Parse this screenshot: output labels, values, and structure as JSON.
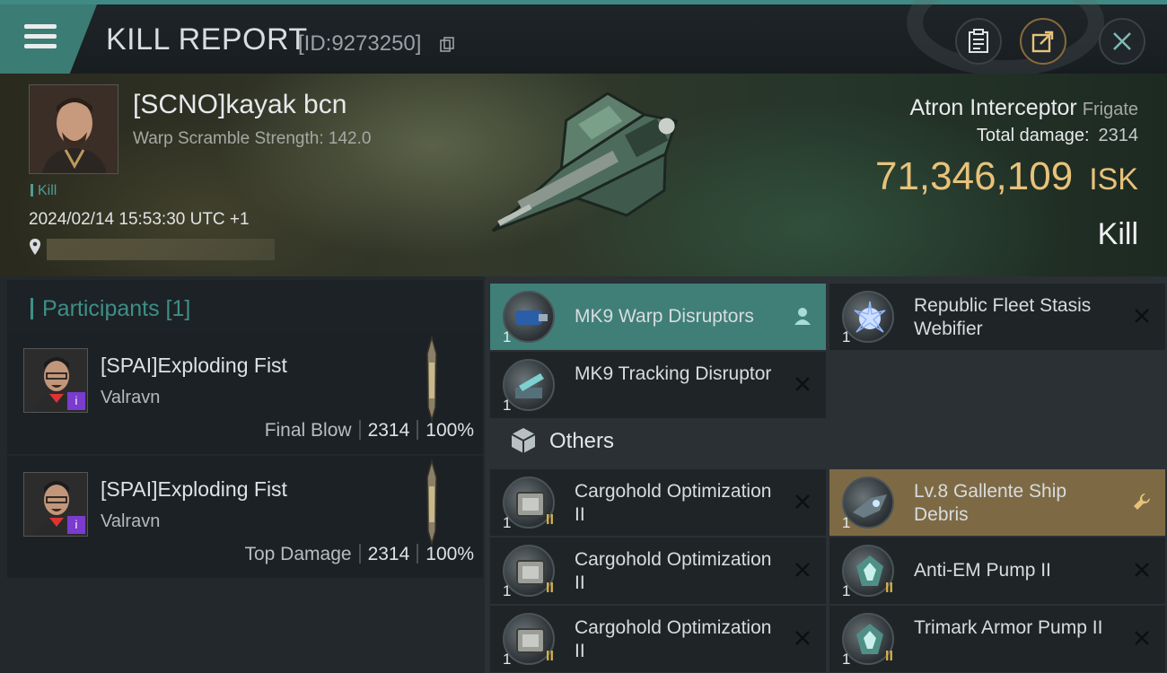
{
  "header": {
    "title": "KILL REPORT",
    "report_id": "[ID:9273250]"
  },
  "victim": {
    "name": "[SCNO]kayak bcn",
    "warp_scramble": "Warp Scramble Strength: 142.0",
    "kill_tag": "Kill",
    "datetime": "2024/02/14 15:53:30 UTC +1"
  },
  "ship": {
    "name": "Atron Interceptor",
    "class": "Frigate",
    "total_damage_label": "Total damage:",
    "total_damage": "2314",
    "isk_value": "71,346,109",
    "isk_unit": "ISK",
    "result": "Kill"
  },
  "participants": {
    "header": "Participants [1]",
    "rows": [
      {
        "name": "[SPAI]Exploding Fist",
        "ship": "Valravn",
        "role": "Final Blow",
        "damage": "2314",
        "percent": "100%"
      },
      {
        "name": "[SPAI]Exploding Fist",
        "ship": "Valravn",
        "role": "Top Damage",
        "damage": "2314",
        "percent": "100%"
      }
    ]
  },
  "items": {
    "mk9_warp": {
      "name": "MK9 Warp Disruptors",
      "qty": "1"
    },
    "webifier": {
      "name": "Republic Fleet Stasis Webifier",
      "qty": "1"
    },
    "tracking": {
      "name": "MK9 Tracking Disruptor",
      "qty": "1"
    },
    "others_label": "Others",
    "cargo1": {
      "name": "Cargohold Optimization II",
      "qty": "1",
      "tier": "II"
    },
    "debris": {
      "name": "Lv.8 Gallente Ship Debris",
      "qty": "1"
    },
    "cargo2": {
      "name": "Cargohold Optimization II",
      "qty": "1",
      "tier": "II"
    },
    "antiem": {
      "name": "Anti-EM Pump II",
      "qty": "1",
      "tier": "II"
    },
    "cargo3": {
      "name": "Cargohold Optimization II",
      "qty": "1",
      "tier": "II"
    },
    "trimark": {
      "name": "Trimark Armor Pump II",
      "qty": "1",
      "tier": "II"
    }
  },
  "icons": {
    "menu": "hamburger-icon",
    "copy": "copy-icon",
    "clipboard": "clipboard-icon",
    "share": "share-icon",
    "close": "close-icon",
    "pin": "location-pin-icon",
    "pilot": "pilot-icon",
    "wrench": "wrench-icon",
    "cube": "cube-icon",
    "remove": "x-icon"
  },
  "colors": {
    "accent_teal": "#3f8b83",
    "isk_gold": "#e8c27a",
    "debris_gold": "#7d6a45"
  }
}
